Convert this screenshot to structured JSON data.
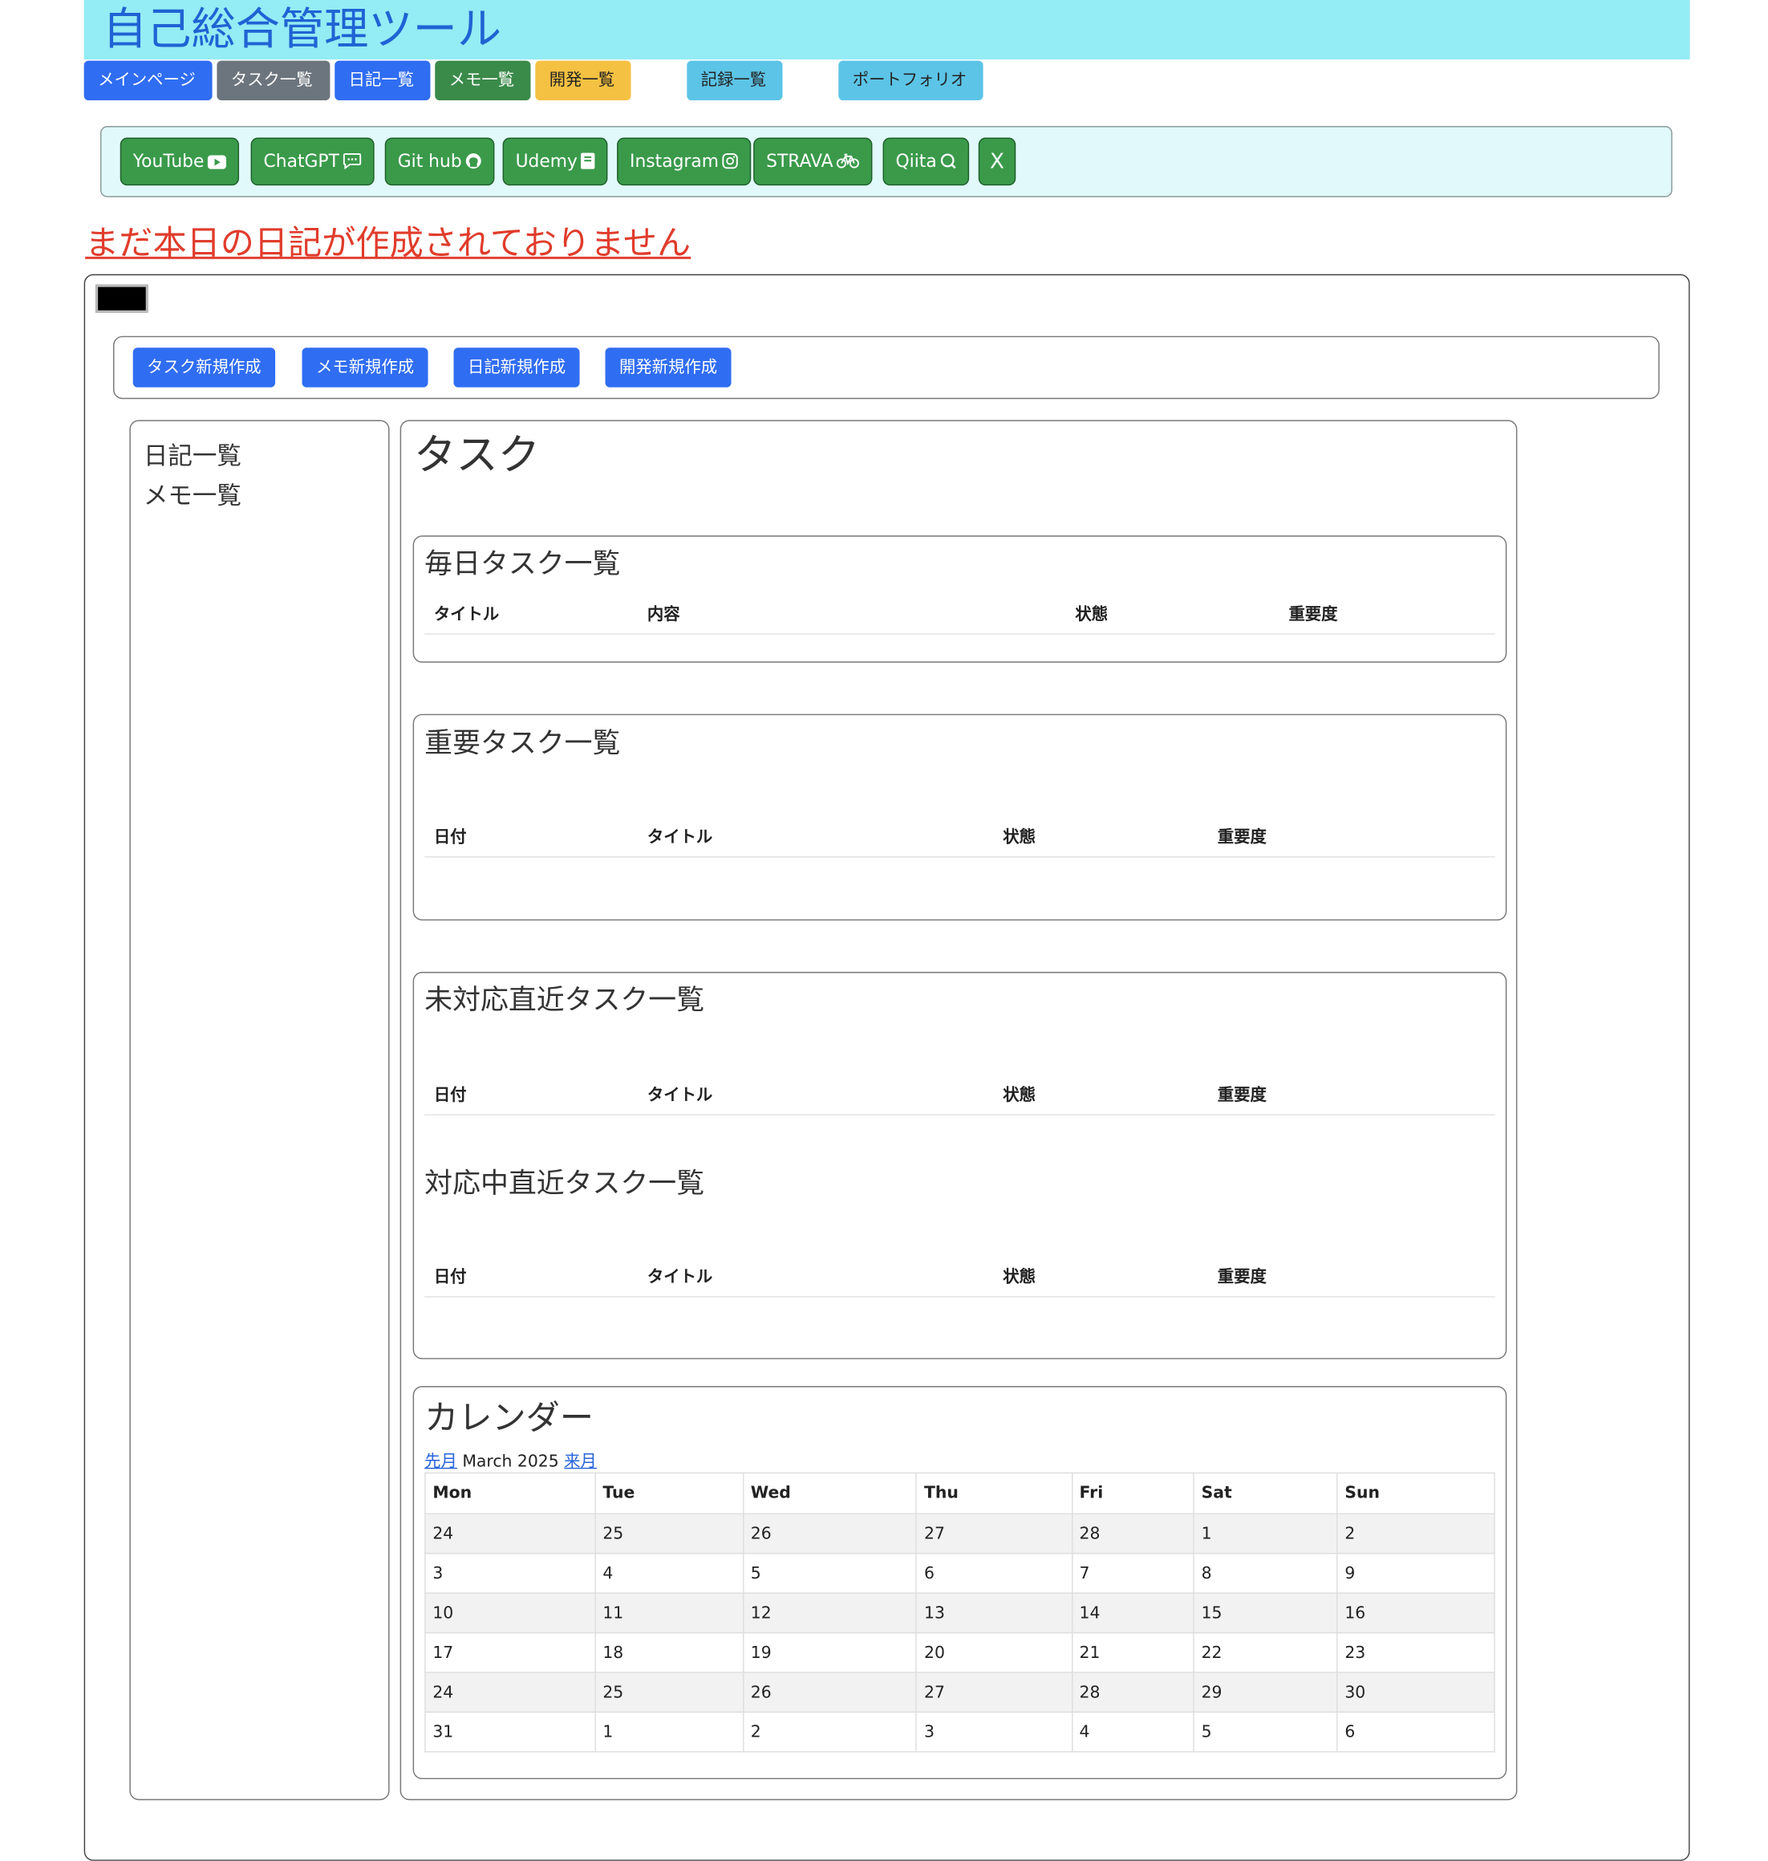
{
  "header": {
    "title": "自己総合管理ツール"
  },
  "nav": [
    {
      "label": "メインページ",
      "color": "#2f6df2"
    },
    {
      "label": "タスク一覧",
      "color": "#6c757d"
    },
    {
      "label": "日記一覧",
      "color": "#2f6df2"
    },
    {
      "label": "メモ一覧",
      "color": "#3a8a4a"
    },
    {
      "label": "開発一覧",
      "color": "#f5c142"
    },
    {
      "label": "記録一覧",
      "color": "#5cc4e6"
    },
    {
      "label": "ポートフォリオ",
      "color": "#5cc4e6"
    }
  ],
  "links": [
    {
      "label": "YouTube",
      "icon": "youtube-icon"
    },
    {
      "label": "ChatGPT",
      "icon": "chat-icon"
    },
    {
      "label": "Git hub",
      "icon": "github-icon"
    },
    {
      "label": "Udemy",
      "icon": "book-icon"
    },
    {
      "label": "Instagram",
      "icon": "instagram-icon"
    },
    {
      "label": "STRAVA",
      "icon": "bicycle-icon"
    },
    {
      "label": "Qiita",
      "icon": "qiita-icon"
    },
    {
      "label": "X",
      "icon": "x-icon"
    }
  ],
  "warning": "まだ本日の日記が作成されておりません",
  "create": [
    {
      "label": "タスク新規作成"
    },
    {
      "label": "メモ新規作成"
    },
    {
      "label": "日記新規作成"
    },
    {
      "label": "開発新規作成"
    }
  ],
  "sidebar": {
    "items": [
      {
        "label": "日記一覧"
      },
      {
        "label": "メモ一覧"
      }
    ]
  },
  "tasks": {
    "title": "タスク",
    "daily": {
      "title": "毎日タスク一覧",
      "cols": [
        "タイトル",
        "内容",
        "状態",
        "重要度"
      ]
    },
    "important": {
      "title": "重要タスク一覧",
      "cols": [
        "日付",
        "タイトル",
        "状態",
        "重要度"
      ]
    },
    "pending": {
      "title": "未対応直近タスク一覧",
      "cols": [
        "日付",
        "タイトル",
        "状態",
        "重要度"
      ]
    },
    "inprogress": {
      "title": "対応中直近タスク一覧",
      "cols": [
        "日付",
        "タイトル",
        "状態",
        "重要度"
      ]
    }
  },
  "calendar": {
    "title": "カレンダー",
    "prev": "先月",
    "month": "March 2025",
    "next": "来月",
    "days": [
      "Mon",
      "Tue",
      "Wed",
      "Thu",
      "Fri",
      "Sat",
      "Sun"
    ],
    "weeks": [
      [
        "24",
        "25",
        "26",
        "27",
        "28",
        "1",
        "2"
      ],
      [
        "3",
        "4",
        "5",
        "6",
        "7",
        "8",
        "9"
      ],
      [
        "10",
        "11",
        "12",
        "13",
        "14",
        "15",
        "16"
      ],
      [
        "17",
        "18",
        "19",
        "20",
        "21",
        "22",
        "23"
      ],
      [
        "24",
        "25",
        "26",
        "27",
        "28",
        "29",
        "30"
      ],
      [
        "31",
        "1",
        "2",
        "3",
        "4",
        "5",
        "6"
      ]
    ]
  }
}
